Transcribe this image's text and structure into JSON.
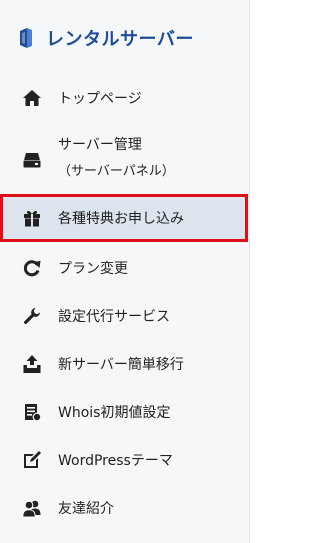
{
  "brand": {
    "title": "レンタルサーバー",
    "accent_color": "#1d4c9a"
  },
  "nav": {
    "items": [
      {
        "icon": "home-icon",
        "label": "トップページ"
      },
      {
        "icon": "server-icon",
        "label": "サーバー管理",
        "sublabel": "（サーバーパネル）"
      },
      {
        "icon": "gift-icon",
        "label": "各種特典お申し込み",
        "active": true
      },
      {
        "icon": "refresh-icon",
        "label": "プラン変更"
      },
      {
        "icon": "wrench-icon",
        "label": "設定代行サービス"
      },
      {
        "icon": "upload-box-icon",
        "label": "新サーバー簡単移行"
      },
      {
        "icon": "document-list-icon",
        "label": "Whois初期値設定"
      },
      {
        "icon": "edit-square-icon",
        "label": "WordPressテーマ"
      },
      {
        "icon": "users-icon",
        "label": "友達紹介"
      }
    ]
  },
  "highlight_color": "#e00e16"
}
